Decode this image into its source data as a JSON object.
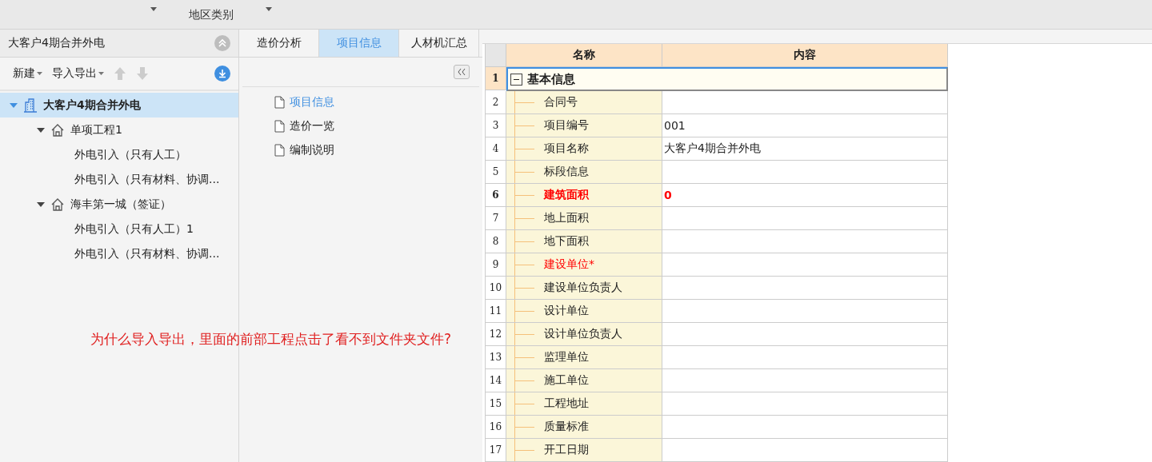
{
  "toolbar": {
    "labels": [
      "地区类别"
    ]
  },
  "sidebar": {
    "title": "大客户4期合并外电",
    "actions": [
      "新建",
      "导入导出"
    ],
    "tree": [
      {
        "label": "大客户4期合并外电",
        "kind": "project",
        "selected": true,
        "expanded": true,
        "children": [
          {
            "label": "单项工程1",
            "kind": "single",
            "selected": false,
            "expanded": true,
            "children": [
              {
                "label": "外电引入（只有人工）",
                "selected": false
              },
              {
                "label": "外电引入（只有材料、协调...",
                "selected": false
              }
            ]
          },
          {
            "label": "海丰第一城（签证）",
            "kind": "single",
            "selected": false,
            "expanded": true,
            "children": [
              {
                "label": "外电引入（只有人工）1",
                "selected": false
              },
              {
                "label": "外电引入（只有材料、协调...",
                "selected": false
              }
            ]
          }
        ]
      }
    ]
  },
  "tabs": [
    {
      "label": "造价分析",
      "selected": false
    },
    {
      "label": "项目信息",
      "selected": true
    },
    {
      "label": "人材机汇总",
      "selected": false
    }
  ],
  "nav": [
    {
      "label": "项目信息",
      "selected": true
    },
    {
      "label": "造价一览",
      "selected": false
    },
    {
      "label": "编制说明",
      "selected": false
    }
  ],
  "table": {
    "columns": [
      "名称",
      "内容"
    ],
    "rows": [
      {
        "no": "1",
        "name": "基本信息",
        "kind": "group",
        "expanded": true,
        "selected": true
      },
      {
        "no": "2",
        "name": "合同号",
        "value": "",
        "kind": "item",
        "selected": false,
        "flagged": false,
        "emphasized": false
      },
      {
        "no": "3",
        "name": "项目编号",
        "value": "001",
        "kind": "item",
        "selected": false,
        "flagged": false,
        "emphasized": false
      },
      {
        "no": "4",
        "name": "项目名称",
        "value": "大客户4期合并外电",
        "kind": "item",
        "selected": false,
        "flagged": false,
        "emphasized": false
      },
      {
        "no": "5",
        "name": "标段信息",
        "value": "",
        "kind": "item",
        "selected": false,
        "flagged": false,
        "emphasized": false
      },
      {
        "no": "6",
        "name": "建筑面积",
        "value": "0",
        "kind": "item",
        "selected": false,
        "flagged": true,
        "emphasized": true
      },
      {
        "no": "7",
        "name": "地上面积",
        "value": "",
        "kind": "item",
        "selected": false,
        "flagged": false,
        "emphasized": false
      },
      {
        "no": "8",
        "name": "地下面积",
        "value": "",
        "kind": "item",
        "selected": false,
        "flagged": false,
        "emphasized": false
      },
      {
        "no": "9",
        "name": "建设单位*",
        "value": "",
        "kind": "item",
        "selected": false,
        "flagged": true,
        "emphasized": false
      },
      {
        "no": "10",
        "name": "建设单位负责人",
        "value": "",
        "kind": "item",
        "selected": false,
        "flagged": false,
        "emphasized": false
      },
      {
        "no": "11",
        "name": "设计单位",
        "value": "",
        "kind": "item",
        "selected": false,
        "flagged": false,
        "emphasized": false
      },
      {
        "no": "12",
        "name": "设计单位负责人",
        "value": "",
        "kind": "item",
        "selected": false,
        "flagged": false,
        "emphasized": false
      },
      {
        "no": "13",
        "name": "监理单位",
        "value": "",
        "kind": "item",
        "selected": false,
        "flagged": false,
        "emphasized": false
      },
      {
        "no": "14",
        "name": "施工单位",
        "value": "",
        "kind": "item",
        "selected": false,
        "flagged": false,
        "emphasized": false
      },
      {
        "no": "15",
        "name": "工程地址",
        "value": "",
        "kind": "item",
        "selected": false,
        "flagged": false,
        "emphasized": false
      },
      {
        "no": "16",
        "name": "质量标准",
        "value": "",
        "kind": "item",
        "selected": false,
        "flagged": false,
        "emphasized": false
      },
      {
        "no": "17",
        "name": "开工日期",
        "value": "",
        "kind": "item",
        "selected": false,
        "flagged": false,
        "emphasized": false
      }
    ]
  },
  "annotation": "为什么导入导出，里面的前部工程点击了看不到文件夹文件?"
}
